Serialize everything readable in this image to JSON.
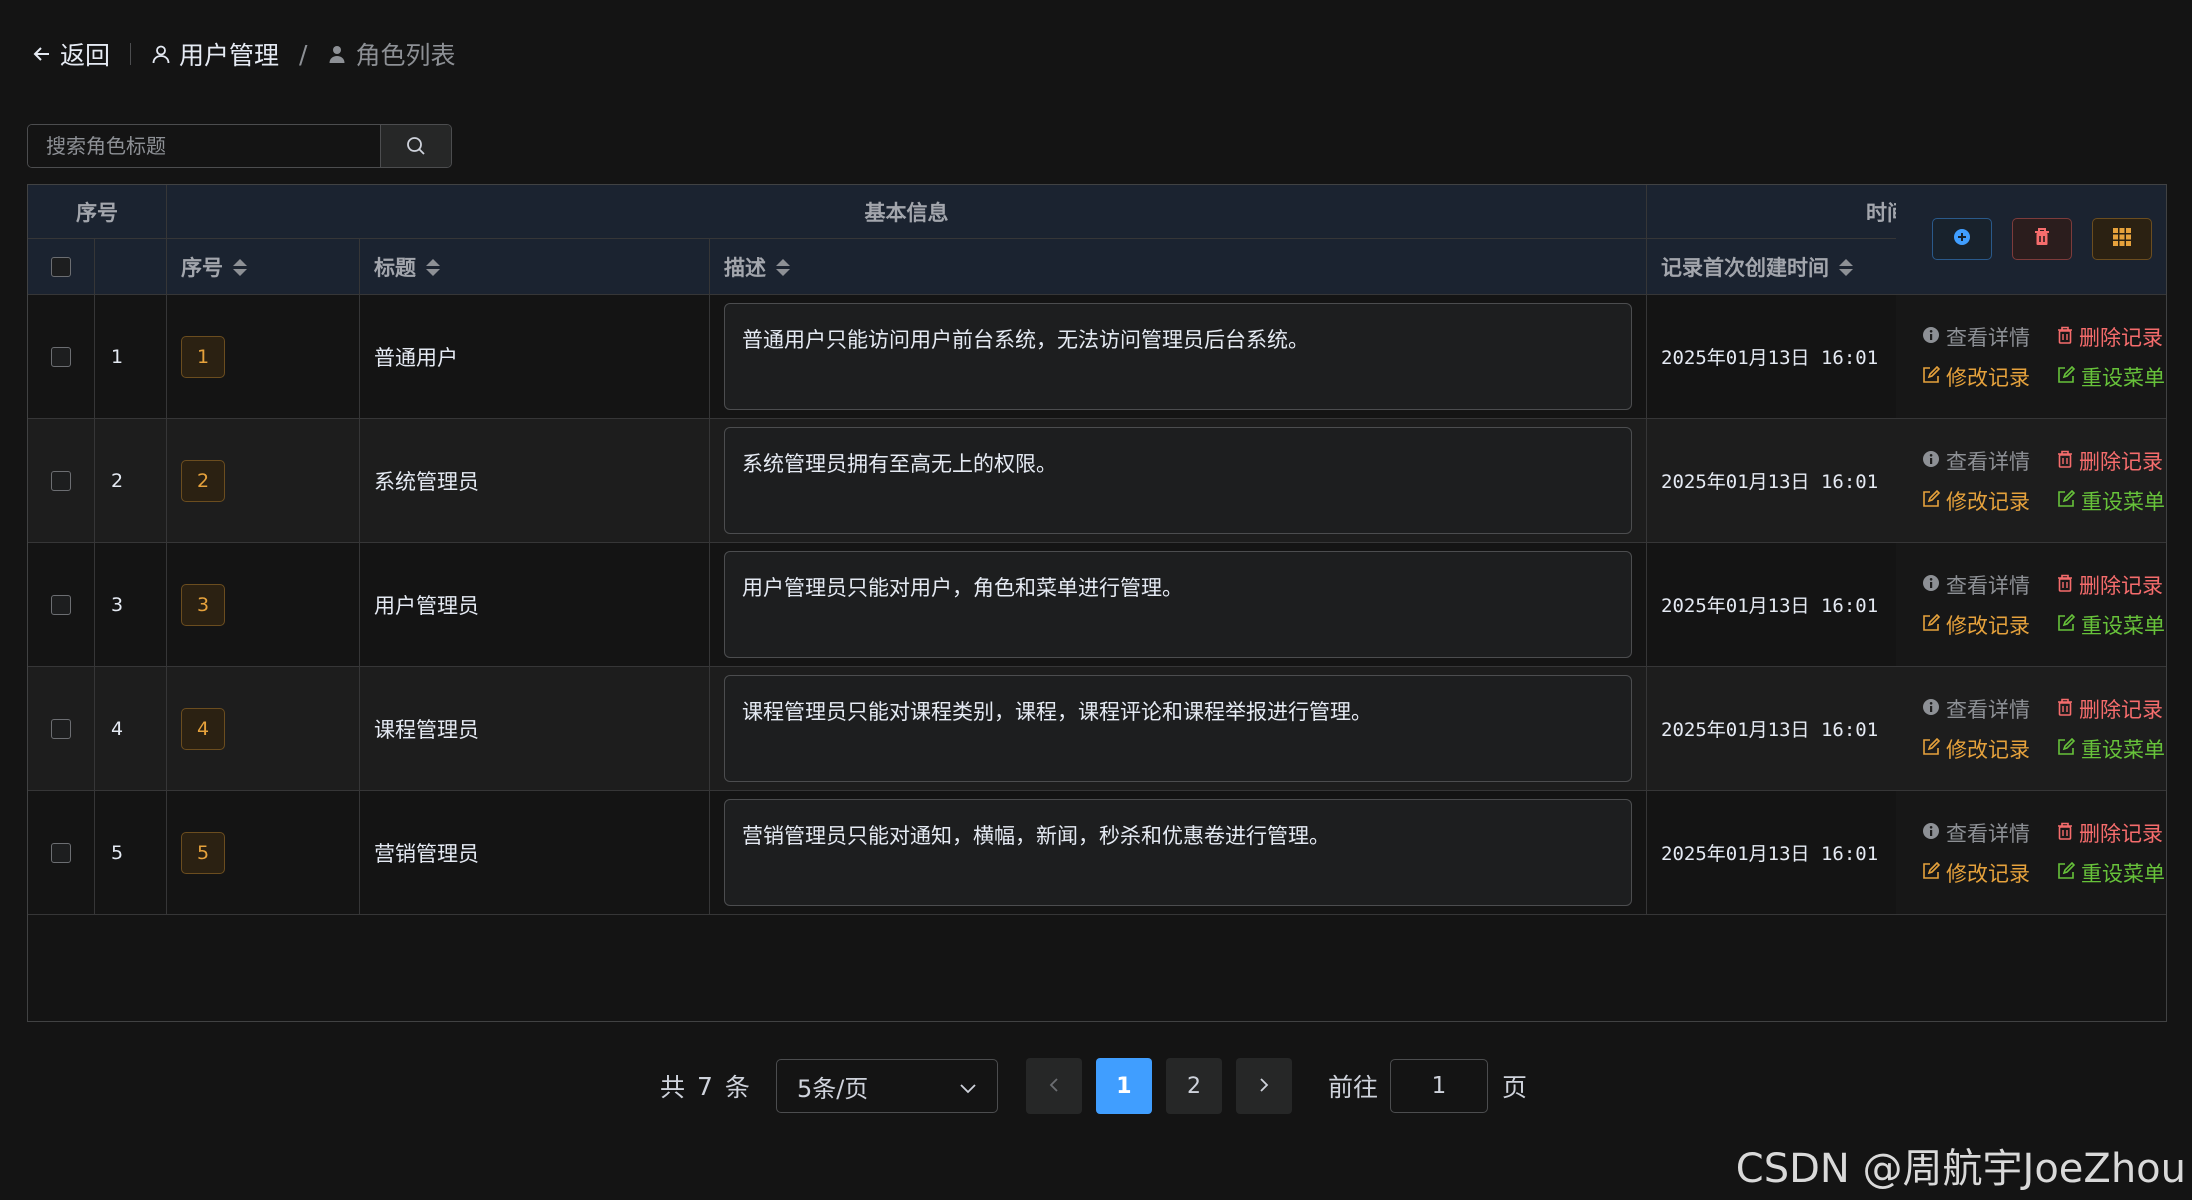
{
  "header": {
    "back_label": "返回",
    "crumb_current": "用户管理",
    "separator": "/",
    "crumb_sub": "角色列表"
  },
  "search": {
    "placeholder": "搜索角色标题"
  },
  "table": {
    "group_headers": {
      "index": "序号",
      "basic": "基本信息",
      "time": "时间"
    },
    "columns": {
      "id": "序号",
      "title": "标题",
      "desc": "描述",
      "created": "记录首次创建时间"
    },
    "toolbar": {
      "add_icon": "plus-circle-icon",
      "delete_icon": "trash-icon",
      "columns_icon": "grid-icon"
    },
    "ops": {
      "view": "查看详情",
      "delete": "删除记录",
      "edit": "修改记录",
      "reset": "重设菜单"
    },
    "rows": [
      {
        "index": "1",
        "id": "1",
        "title": "普通用户",
        "desc": "普通用户只能访问用户前台系统，无法访问管理员后台系统。",
        "created": "2025年01月13日 16:01"
      },
      {
        "index": "2",
        "id": "2",
        "title": "系统管理员",
        "desc": "系统管理员拥有至高无上的权限。",
        "created": "2025年01月13日 16:01"
      },
      {
        "index": "3",
        "id": "3",
        "title": "用户管理员",
        "desc": "用户管理员只能对用户，角色和菜单进行管理。",
        "created": "2025年01月13日 16:01"
      },
      {
        "index": "4",
        "id": "4",
        "title": "课程管理员",
        "desc": "课程管理员只能对课程类别，课程，课程评论和课程举报进行管理。",
        "created": "2025年01月13日 16:01"
      },
      {
        "index": "5",
        "id": "5",
        "title": "营销管理员",
        "desc": "营销管理员只能对通知，横幅，新闻，秒杀和优惠卷进行管理。",
        "created": "2025年01月13日 16:01"
      }
    ]
  },
  "pagination": {
    "total_prefix": "共",
    "total": "7",
    "total_suffix": "条",
    "page_size": "5条/页",
    "pages": [
      "1",
      "2"
    ],
    "current_page": "1",
    "goto_prefix": "前往",
    "goto_value": "1",
    "goto_suffix": "页"
  },
  "watermark": "CSDN @周航宇JoeZhou",
  "colors": {
    "accent": "#409eff",
    "danger": "#f56c6c",
    "warning": "#e6a23c",
    "success": "#67c23a",
    "header_bg": "#1b2330"
  }
}
